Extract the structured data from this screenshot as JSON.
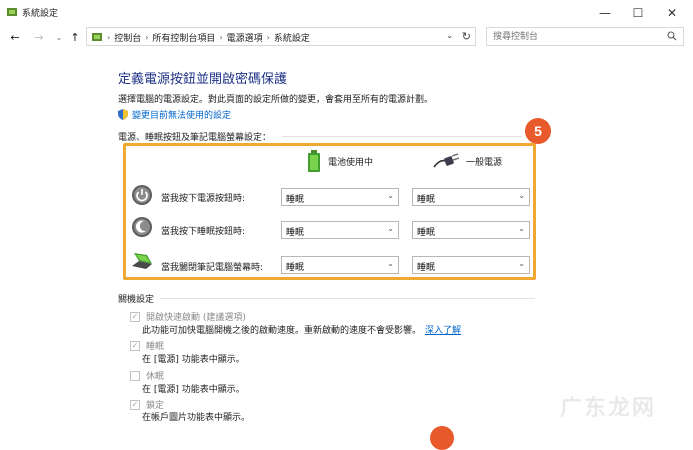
{
  "window": {
    "title": "系統設定",
    "minimize": "—",
    "maximize": "☐",
    "close": "✕"
  },
  "nav": {
    "back": "←",
    "forward": "→",
    "dropdown": "⌄",
    "up": "↑",
    "breadcrumbs": [
      "控制台",
      "所有控制台項目",
      "電源選項",
      "系統設定"
    ],
    "breadcrumb_sep": "›",
    "addr_dropdown": "⌄",
    "refresh": "↻"
  },
  "search": {
    "placeholder": "搜尋控制台"
  },
  "page": {
    "title": "定義電源按鈕並開啟密碼保護",
    "subtitle": "選擇電腦的電源設定。對此頁面的設定所做的變更，會套用至所有的電源計劃。",
    "change_link": "變更目前無法使用的設定"
  },
  "power_section": {
    "title": "電源、睡眠按鈕及筆記電腦螢幕設定：",
    "col_battery": "電池使用中",
    "col_plugged": "一般電源",
    "rows": [
      {
        "label": "當我按下電源按鈕時:",
        "icon": "power-button-icon",
        "battery": "睡眠",
        "plugged": "睡眠"
      },
      {
        "label": "當我按下睡眠按鈕時:",
        "icon": "sleep-button-icon",
        "battery": "睡眠",
        "plugged": "睡眠"
      },
      {
        "label": "當我闔閉筆記電腦螢幕時:",
        "icon": "laptop-lid-icon",
        "battery": "睡眠",
        "plugged": "睡眠"
      }
    ],
    "chevron": "⌄",
    "badge": "5"
  },
  "shutdown_section": {
    "title": "關機設定",
    "items": [
      {
        "label": "開啟快速啟動 (建議選項)",
        "desc": "此功能可加快電腦開機之後的啟動速度。重新啟動的速度不會受影響。",
        "link": "深入了解",
        "checked": true
      },
      {
        "label": "睡眠",
        "desc": "在 [電源] 功能表中顯示。",
        "checked": true
      },
      {
        "label": "休眠",
        "desc": "在 [電源] 功能表中顯示。",
        "checked": false
      },
      {
        "label": "鎖定",
        "desc": "在帳戶圖片功能表中顯示。",
        "checked": true
      }
    ],
    "check_mark": "✓"
  },
  "watermark": "广东龙网",
  "colors": {
    "accent": "#1e3287",
    "highlight": "#f0a833",
    "badge": "#e85a2c",
    "link": "#0066cc"
  }
}
